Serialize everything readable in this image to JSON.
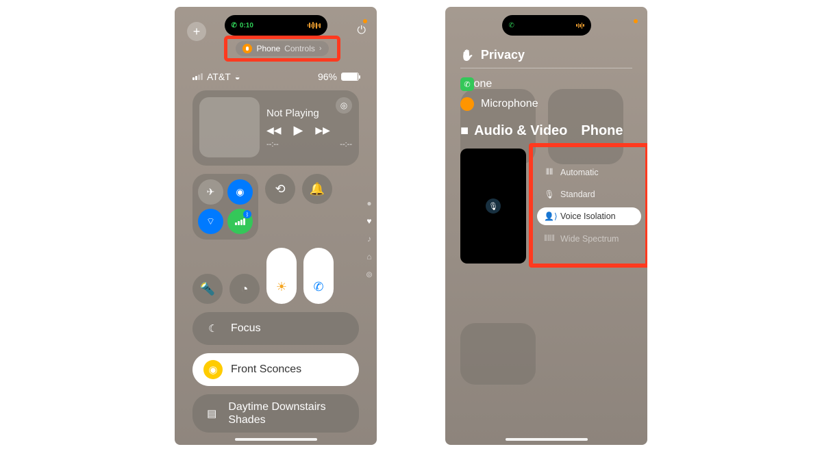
{
  "left": {
    "island": {
      "call_time": "0:10"
    },
    "banner": {
      "app": "Phone",
      "sub": "Controls"
    },
    "status": {
      "carrier": "AT&T",
      "battery_pct": "96%",
      "battery_fill": 96
    },
    "media": {
      "title": "Not Playing",
      "time_left": "--:--",
      "time_right": "--:--"
    },
    "pills": {
      "focus": "Focus",
      "sconces": "Front Sconces",
      "shades": "Daytime Downstairs Shades"
    }
  },
  "right": {
    "privacy_heading": "Privacy",
    "privacy_items": {
      "phone": "Phone",
      "mic": "Microphone"
    },
    "av_heading": "Audio & Video",
    "av_app": "Phone",
    "modes": {
      "automatic": "Automatic",
      "standard": "Standard",
      "voice_isolation": "Voice Isolation",
      "wide_spectrum": "Wide Spectrum"
    }
  }
}
